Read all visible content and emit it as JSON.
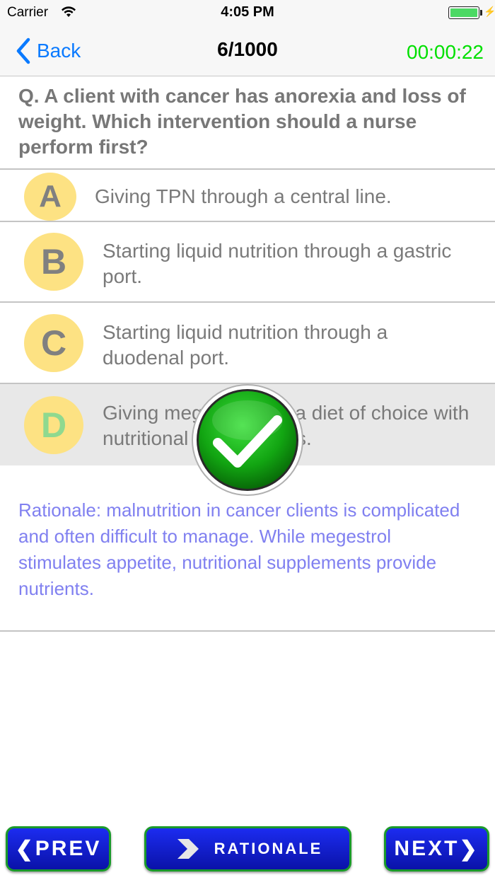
{
  "status_bar": {
    "carrier": "Carrier",
    "time": "4:05 PM",
    "battery_color": "#4cd964"
  },
  "nav": {
    "back_label": "Back",
    "title": "6/1000",
    "timer": "00:00:22",
    "timer_color": "#00e000"
  },
  "question": {
    "text": "Q. A client with cancer has anorexia and loss of weight. Which intervention should a nurse perform first?"
  },
  "options": [
    {
      "letter": "A",
      "text": "Giving TPN through a central line."
    },
    {
      "letter": "B",
      "text": "Starting liquid nutrition through a gastric port."
    },
    {
      "letter": "C",
      "text": "Starting liquid nutrition through a duodenal port."
    },
    {
      "letter": "D",
      "text": "Giving megestrol and a diet of choice with nutritional supplements.",
      "selected": true,
      "correct": true
    }
  ],
  "feedback_icon": "checkmark-icon",
  "rationale": {
    "text": "Rationale: malnutrition in cancer clients is complicated and often difficult to manage. While megestrol stimulates appetite, nutritional supplements provide nutrients."
  },
  "footer": {
    "prev_label": "PREV",
    "rationale_label": "RATIONALE",
    "next_label": "NEXT",
    "button_color": "#1c2cf0",
    "button_border": "#1a9a2a"
  }
}
